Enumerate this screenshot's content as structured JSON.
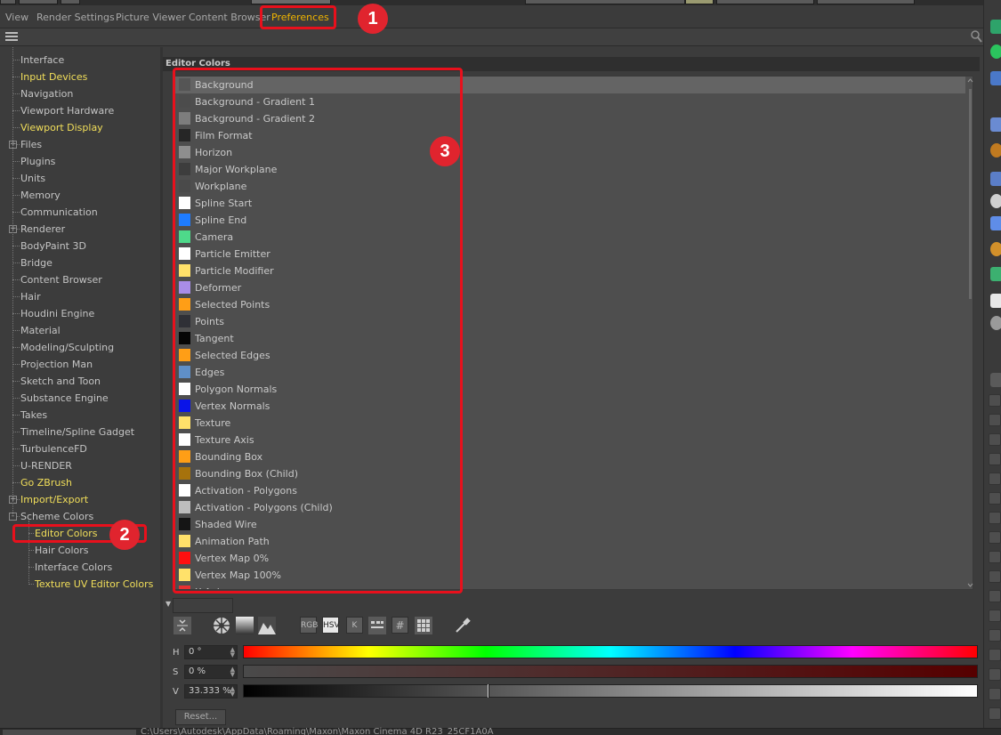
{
  "menubar": {
    "items": [
      "View",
      "Render Settings",
      "Picture Viewer",
      "Content Browser",
      "Preferences"
    ],
    "active": "Preferences"
  },
  "callouts": [
    "1",
    "2",
    "3"
  ],
  "tree": {
    "items": [
      {
        "label": "Interface",
        "yellow": false
      },
      {
        "label": "Input Devices",
        "yellow": true
      },
      {
        "label": "Navigation",
        "yellow": false
      },
      {
        "label": "Viewport Hardware",
        "yellow": false
      },
      {
        "label": "Viewport Display",
        "yellow": true
      },
      {
        "label": "Files",
        "yellow": false,
        "expander": "+"
      },
      {
        "label": "Plugins",
        "yellow": false
      },
      {
        "label": "Units",
        "yellow": false
      },
      {
        "label": "Memory",
        "yellow": false
      },
      {
        "label": "Communication",
        "yellow": false
      },
      {
        "label": "Renderer",
        "yellow": false,
        "expander": "+"
      },
      {
        "label": "BodyPaint 3D",
        "yellow": false
      },
      {
        "label": "Bridge",
        "yellow": false
      },
      {
        "label": "Content Browser",
        "yellow": false
      },
      {
        "label": "Hair",
        "yellow": false
      },
      {
        "label": "Houdini Engine",
        "yellow": false
      },
      {
        "label": "Material",
        "yellow": false
      },
      {
        "label": "Modeling/Sculpting",
        "yellow": false
      },
      {
        "label": "Projection Man",
        "yellow": false
      },
      {
        "label": "Sketch and Toon",
        "yellow": false
      },
      {
        "label": "Substance Engine",
        "yellow": false
      },
      {
        "label": "Takes",
        "yellow": false
      },
      {
        "label": "Timeline/Spline Gadget",
        "yellow": false
      },
      {
        "label": "TurbulenceFD",
        "yellow": false
      },
      {
        "label": "U-RENDER",
        "yellow": false
      },
      {
        "label": "Go ZBrush",
        "yellow": true
      },
      {
        "label": "Import/Export",
        "yellow": true,
        "expander": "+"
      },
      {
        "label": "Scheme Colors",
        "yellow": false,
        "expander": "-"
      },
      {
        "label": "Editor Colors",
        "yellow": true,
        "child": true
      },
      {
        "label": "Hair Colors",
        "yellow": false,
        "child": true
      },
      {
        "label": "Interface Colors",
        "yellow": false,
        "child": true
      },
      {
        "label": "Texture UV Editor Colors",
        "yellow": true,
        "child": true
      }
    ]
  },
  "main": {
    "title": "Editor Colors",
    "colors": [
      {
        "label": "Background",
        "color": "#555555",
        "selected": true
      },
      {
        "label": "Background - Gradient 1",
        "color": "#4c4c4c"
      },
      {
        "label": "Background - Gradient 2",
        "color": "#7d7d7d"
      },
      {
        "label": "Film Format",
        "color": "#262626"
      },
      {
        "label": "Horizon",
        "color": "#8e8e8e"
      },
      {
        "label": "Major Workplane",
        "color": "#3d3d3d"
      },
      {
        "label": "Workplane",
        "color": "#4a4a4a"
      },
      {
        "label": "Spline Start",
        "color": "#ffffff"
      },
      {
        "label": "Spline End",
        "color": "#1e7cff"
      },
      {
        "label": "Camera",
        "color": "#4ed98a"
      },
      {
        "label": "Particle Emitter",
        "color": "#ffffff"
      },
      {
        "label": "Particle Modifier",
        "color": "#ffe16a"
      },
      {
        "label": "Deformer",
        "color": "#a98de8"
      },
      {
        "label": "Selected Points",
        "color": "#ff9e16"
      },
      {
        "label": "Points",
        "color": "#2f3036"
      },
      {
        "label": "Tangent",
        "color": "#050505"
      },
      {
        "label": "Selected Edges",
        "color": "#ff9e16"
      },
      {
        "label": "Edges",
        "color": "#5f8fc8"
      },
      {
        "label": "Polygon Normals",
        "color": "#ffffff"
      },
      {
        "label": "Vertex Normals",
        "color": "#0a14e8"
      },
      {
        "label": "Texture",
        "color": "#ffe16a"
      },
      {
        "label": "Texture Axis",
        "color": "#ffffff"
      },
      {
        "label": "Bounding Box",
        "color": "#ff9e16"
      },
      {
        "label": "Bounding Box (Child)",
        "color": "#a6720c"
      },
      {
        "label": "Activation - Polygons",
        "color": "#ffffff"
      },
      {
        "label": "Activation - Polygons (Child)",
        "color": "#bdbdbd"
      },
      {
        "label": "Shaded Wire",
        "color": "#151515"
      },
      {
        "label": "Animation Path",
        "color": "#ffe16a"
      },
      {
        "label": "Vertex Map 0%",
        "color": "#ff1010"
      },
      {
        "label": "Vertex Map 100%",
        "color": "#ffe16a"
      },
      {
        "label": "X-Axis",
        "color": "#e83030"
      }
    ]
  },
  "picker": {
    "mode_buttons": [
      "RGB",
      "HSV",
      "K",
      "",
      "#",
      ""
    ],
    "active_mode": "HSV",
    "h_label": "H",
    "h_value": "0 °",
    "s_label": "S",
    "s_value": "0 %",
    "v_label": "V",
    "v_value": "33.333 %",
    "v_level": 0.333,
    "reset_label": "Reset..."
  },
  "statusbar": {
    "text": "C:\\Users\\Autodesk\\AppData\\Roaming\\Maxon\\Maxon Cinema 4D R23_25CF1A0A"
  },
  "accent_colors": {
    "callout": "#e0242e",
    "active_menu": "#f0b400",
    "tree_highlight": "#f2df5a"
  }
}
